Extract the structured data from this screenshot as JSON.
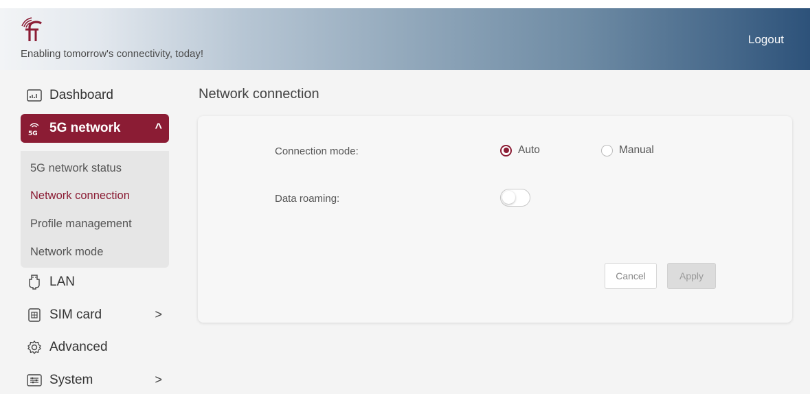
{
  "header": {
    "tagline": "Enabling tomorrow's connectivity, today!",
    "logout_label": "Logout"
  },
  "sidebar": {
    "items": [
      {
        "label": "Dashboard",
        "icon": "dashboard-icon"
      },
      {
        "label": "5G network",
        "icon": "5g-signal-icon",
        "active": true,
        "expanded": true
      },
      {
        "label": "LAN",
        "icon": "ethernet-plug-icon"
      },
      {
        "label": "SIM card",
        "icon": "sim-card-icon"
      },
      {
        "label": "Advanced",
        "icon": "gear-icon"
      },
      {
        "label": "System",
        "icon": "settings-sliders-icon"
      }
    ],
    "submenu": [
      {
        "label": "5G network status"
      },
      {
        "label": "Network connection",
        "current": true
      },
      {
        "label": "Profile management"
      },
      {
        "label": "Network mode"
      }
    ]
  },
  "main": {
    "title": "Network connection",
    "connection_mode": {
      "label": "Connection mode:",
      "options": [
        "Auto",
        "Manual"
      ],
      "selected": "Auto"
    },
    "data_roaming": {
      "label": "Data roaming:",
      "enabled": false
    },
    "buttons": {
      "cancel": "Cancel",
      "apply": "Apply"
    }
  },
  "colors": {
    "accent": "#8b1c34",
    "header_gradient_end": "#2d527a"
  }
}
